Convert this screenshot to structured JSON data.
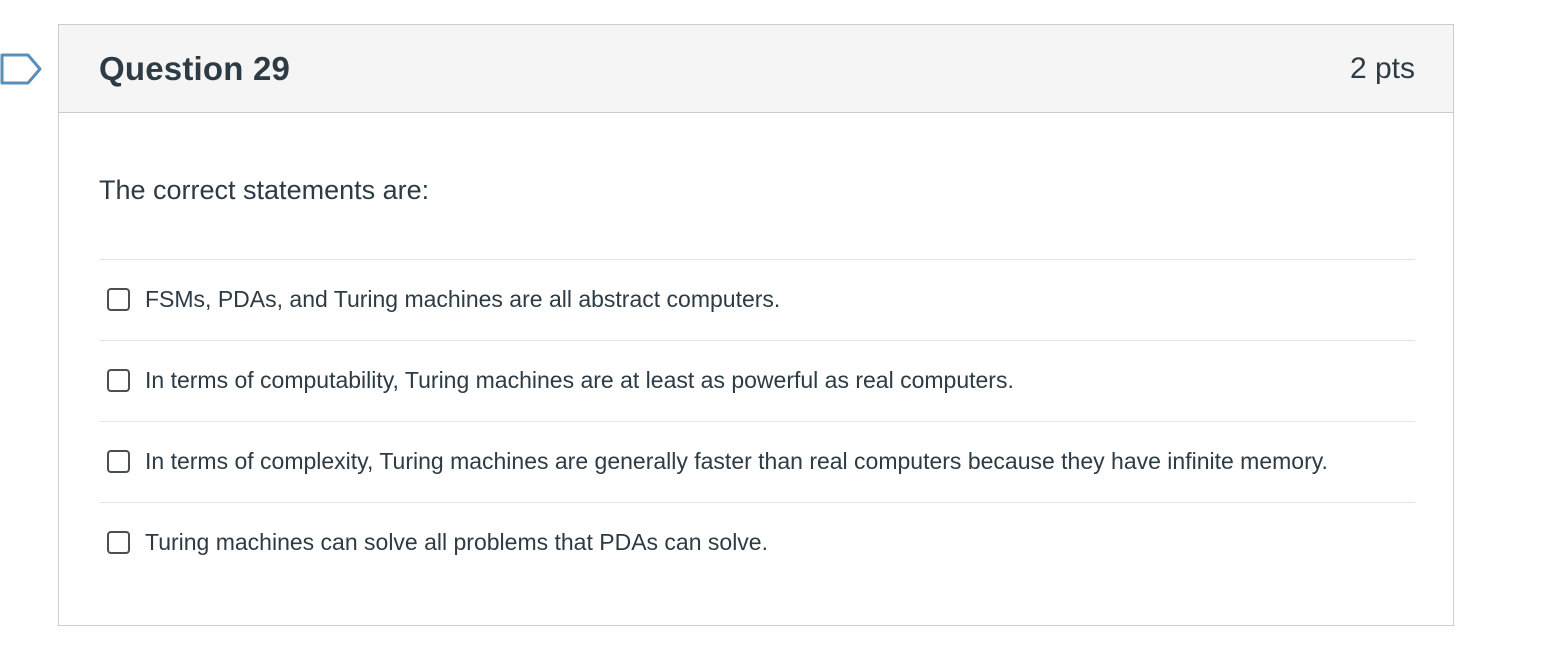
{
  "question": {
    "title": "Question 29",
    "points": "2 pts",
    "prompt": "The correct statements are:",
    "flag_icon": "bookmark-flag-icon"
  },
  "answers": [
    {
      "label": "FSMs, PDAs, and Turing machines are all abstract computers.",
      "checked": false
    },
    {
      "label": "In terms of computability, Turing machines are at least as powerful as real computers.",
      "checked": false
    },
    {
      "label": "In terms of complexity, Turing machines are generally faster than real computers because they have infinite memory.",
      "checked": false
    },
    {
      "label": "Turing machines can solve all problems that PDAs can solve.",
      "checked": false
    }
  ],
  "colors": {
    "header_bg": "#f5f5f5",
    "border": "#c7cdd1",
    "text": "#2d3b45",
    "flag_stroke": "#5a8fb8"
  }
}
